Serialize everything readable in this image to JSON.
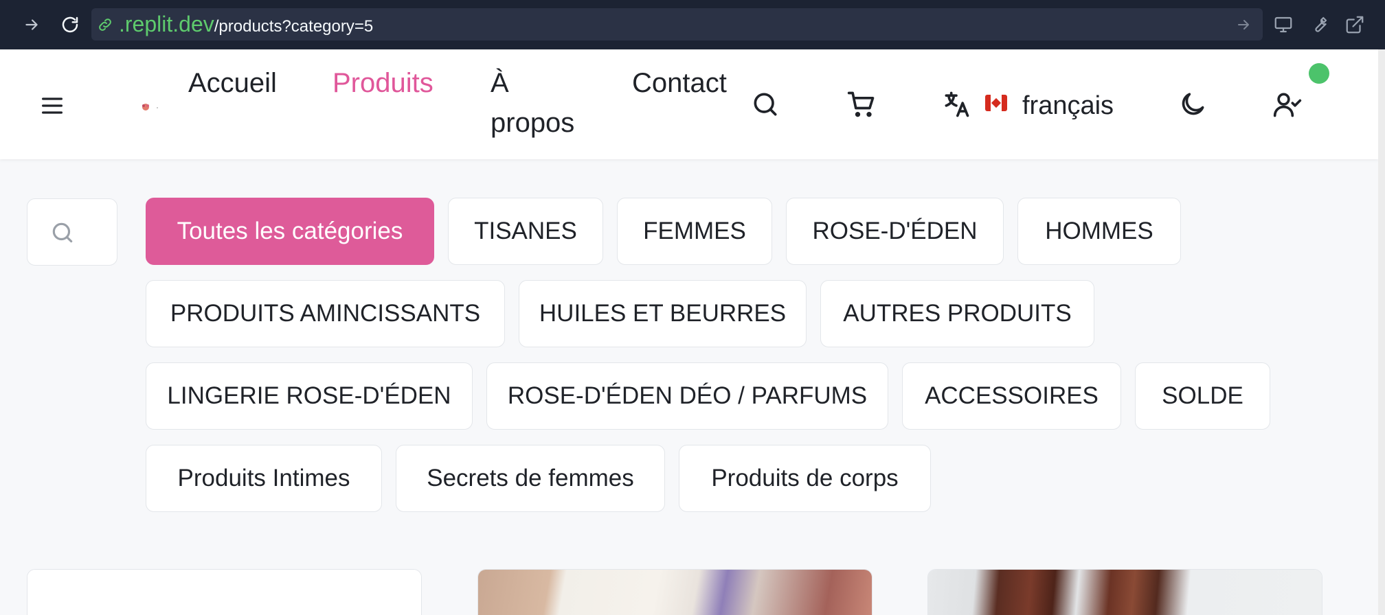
{
  "browser": {
    "url_host": ".replit.dev",
    "url_path": "/products?category=5"
  },
  "header": {
    "nav": [
      {
        "label": "Accueil",
        "active": false
      },
      {
        "label": "Produits",
        "active": true
      },
      {
        "label": "À propos",
        "active": false
      },
      {
        "label": "Contact",
        "active": false
      }
    ],
    "language": "français",
    "icons": [
      "menu-icon",
      "search-icon",
      "cart-icon",
      "translate-icon",
      "canada-flag-icon",
      "moon-icon",
      "user-check-icon"
    ],
    "accent_color": "#e0579a",
    "status_color": "#4cc36b"
  },
  "categories": [
    {
      "label": "Toutes les catégories",
      "active": true
    },
    {
      "label": "TISANES",
      "active": false
    },
    {
      "label": "FEMMES",
      "active": false
    },
    {
      "label": "ROSE-D'ÉDEN",
      "active": false
    },
    {
      "label": "HOMMES",
      "active": false
    },
    {
      "label": "PRODUITS AMINCISSANTS",
      "active": false
    },
    {
      "label": "HUILES ET BEURRES",
      "active": false
    },
    {
      "label": "AUTRES PRODUITS",
      "active": false
    },
    {
      "label": "LINGERIE ROSE-D'ÉDEN",
      "active": false
    },
    {
      "label": "ROSE-D'ÉDEN DÉO / PARFUMS",
      "active": false
    },
    {
      "label": "ACCESSOIRES",
      "active": false
    },
    {
      "label": "SOLDE",
      "active": false
    },
    {
      "label": "Produits Intimes",
      "active": false
    },
    {
      "label": "Secrets de femmes",
      "active": false
    },
    {
      "label": "Produits de corps",
      "active": false
    }
  ]
}
